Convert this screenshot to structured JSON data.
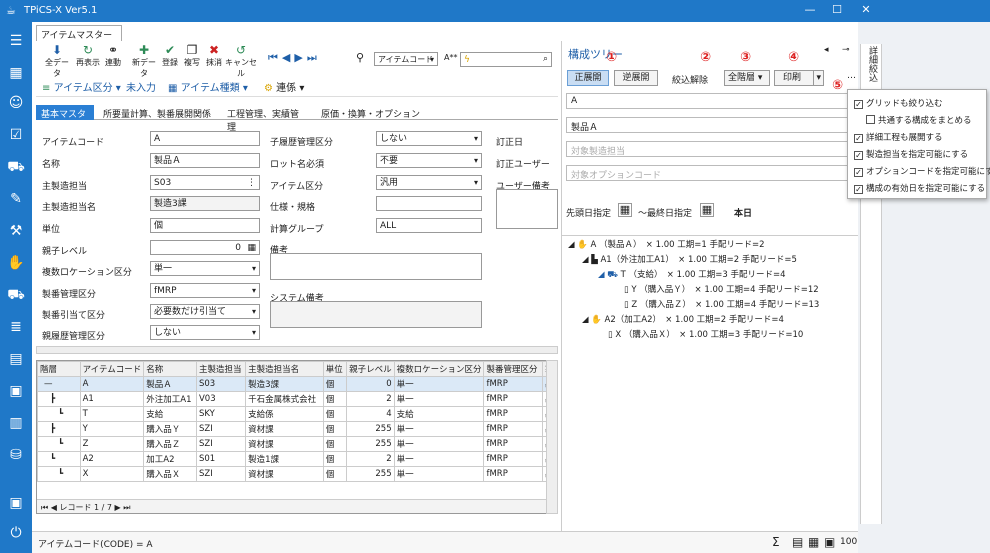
{
  "app": {
    "title": "TPiCS-X Ver5.1",
    "doc_tab": "アイテムマスター",
    "close_x": "✕"
  },
  "window_controls": {
    "minimize": "—",
    "maximize": "☐",
    "close": "✕"
  },
  "toolbar": {
    "all_data": "全データ",
    "redisplay": "再表示",
    "link": "連動",
    "new_data": "新データ",
    "register": "登録",
    "copy": "複写",
    "delete": "抹消",
    "cancel": "キャンセル",
    "search_field": "アイテムコード",
    "search_mode": "A**",
    "item_class": "アイテム区分",
    "not_entered": "未入力",
    "item_type": "アイテム種類",
    "linkage": "連係"
  },
  "form_tabs": [
    "基本マスター",
    "所要量計算、製番展開関係",
    "工程管理、実績管理",
    "原価・換算・オプション"
  ],
  "form": {
    "item_code_label": "アイテムコード",
    "item_code": "A",
    "name_label": "名称",
    "name": "製品Ａ",
    "mfg_owner_label": "主製造担当",
    "mfg_owner": "S03",
    "mfg_owner_name_label": "主製造担当名",
    "mfg_owner_name": "製造3課",
    "unit_label": "単位",
    "unit": "個",
    "parent_level_label": "親子レベル",
    "parent_level": "0",
    "multi_loc_label": "複数ロケーション区分",
    "multi_loc": "単一",
    "mfg_mgmt_label": "製番管理区分",
    "mfg_mgmt": "fMRP",
    "mfg_alloc_label": "製番引当て区分",
    "mfg_alloc": "必要数だけ引当て",
    "parent_hist_label": "親履歴管理区分",
    "parent_hist": "しない",
    "child_hist_label": "子履歴管理区分",
    "child_hist": "しない",
    "lot_required_label": "ロット名必須",
    "lot_required": "不要",
    "item_class_label": "アイテム区分",
    "item_class": "汎用",
    "spec_label": "仕様・規格",
    "spec": "",
    "calc_group_label": "計算グループ",
    "calc_group": "ALL",
    "remarks_label": "備考",
    "sys_remarks_label": "システム備考",
    "revision_date_label": "訂正日",
    "revision_user_label": "訂正ユーザー",
    "user_remarks_label": "ユーザー備考"
  },
  "grid": {
    "headers": [
      "階層",
      "アイテムコード",
      "名称",
      "主製造担当",
      "主製造担当名",
      "単位",
      "親子レベル",
      "複数ロケーション区分",
      "製番管理区分",
      "製"
    ],
    "rows": [
      [
        "—",
        "A",
        "製品Ａ",
        "S03",
        "製造3課",
        "個",
        "0",
        "単一",
        "fMRP",
        "必"
      ],
      [
        "┣",
        "A1",
        "外注加工A1",
        "V03",
        "千石金属株式会社",
        "個",
        "2",
        "単一",
        "fMRP",
        "必"
      ],
      [
        "┗",
        "T",
        "支給",
        "SKY",
        "支給係",
        "個",
        "4",
        "支給",
        "fMRP",
        "必"
      ],
      [
        "┣",
        "Y",
        "購入品Ｙ",
        "SZI",
        "資材課",
        "個",
        "255",
        "単一",
        "fMRP",
        "必"
      ],
      [
        "┗",
        "Z",
        "購入品Ｚ",
        "SZI",
        "資材課",
        "個",
        "255",
        "単一",
        "fMRP",
        "必"
      ],
      [
        "┗",
        "A2",
        "加工A2",
        "S01",
        "製造1課",
        "個",
        "2",
        "単一",
        "fMRP",
        "必"
      ],
      [
        "┗",
        "X",
        "購入品Ｘ",
        "SZI",
        "資材課",
        "個",
        "255",
        "単一",
        "fMRP",
        "必"
      ]
    ],
    "record_nav": "レコード 1 / 7"
  },
  "status": {
    "text": "アイテムコード(CODE) = A",
    "zoom": "100",
    "percent": "%"
  },
  "tree_panel": {
    "title": "構成ツリー",
    "forward": "正展開",
    "reverse": "逆展開",
    "clear_filter": "絞込解除",
    "all_levels": "全階層",
    "print": "印刷",
    "marker1": "①",
    "marker2": "②",
    "marker3": "③",
    "marker4": "④",
    "marker5": "⑤",
    "field_code": "A",
    "field_name": "製品Ａ",
    "ph_owner": "対象製造担当",
    "ph_option": "対象オプションコード",
    "start_label": "先頭日指定",
    "end_label": "〜最終日指定",
    "today": "本日",
    "nodes": [
      "A （製品Ａ）　× 1.00 工期=1 手配リード=2",
      "A1（外注加工A1）　× 1.00 工期=2 手配リード=5",
      "T （支給）　× 1.00 工期=3 手配リード=4",
      "Y （購入品Ｙ）　× 1.00 工期=4 手配リード=12",
      "Z （購入品Ｚ）　× 1.00 工期=4 手配リード=13",
      "A2（加工A2）　× 1.00 工期=2 手配リード=4",
      "X （購入品Ｘ）　× 1.00 工期=3 手配リード=10"
    ]
  },
  "popup": {
    "items": [
      {
        "label": "グリッドも絞り込む",
        "checked": true
      },
      {
        "label": "共通する構成をまとめる",
        "checked": false
      },
      {
        "label": "詳細工程も展開する",
        "checked": true
      },
      {
        "label": "製造担当を指定可能にする",
        "checked": true
      },
      {
        "label": "オプションコードを指定可能にする",
        "checked": true
      },
      {
        "label": "構成の有効日を指定可能にする",
        "checked": true
      }
    ]
  },
  "edge_tab": {
    "label": "詳細絞込"
  },
  "colors": {
    "accent": "#1f78c8",
    "marker": "#dd2222"
  }
}
